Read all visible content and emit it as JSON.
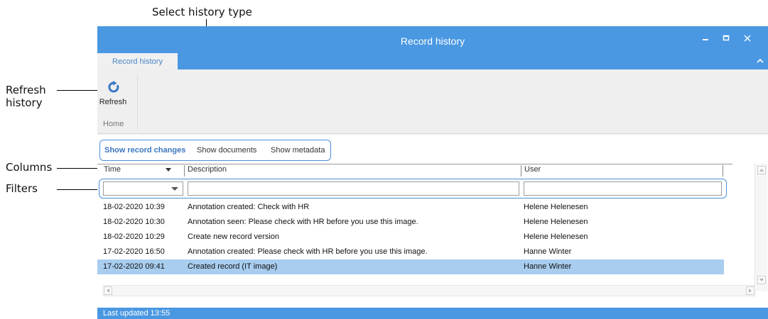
{
  "annotations": {
    "select_history_type": "Select history type",
    "refresh_history_line1": "Refresh",
    "refresh_history_line2": "history",
    "columns": "Columns",
    "filters": "Filters"
  },
  "window": {
    "title": "Record history",
    "minimize_icon": "minimize-icon",
    "maximize_icon": "maximize-icon",
    "close_icon": "close-icon",
    "accent_color": "#4a98e2"
  },
  "ribbon": {
    "tab_label": "Record history",
    "collapse_icon": "chevron-up-icon",
    "refresh_label": "Refresh",
    "refresh_icon": "refresh-icon",
    "group_label": "Home"
  },
  "history_types": [
    {
      "label": "Show record changes",
      "active": true
    },
    {
      "label": "Show documents",
      "active": false
    },
    {
      "label": "Show metadata",
      "active": false
    }
  ],
  "table": {
    "columns": [
      "Time",
      "Description",
      "User"
    ],
    "rows": [
      {
        "time": "18-02-2020 10:39",
        "description": "Annotation created: Check with HR",
        "user": "Helene Helenesen"
      },
      {
        "time": "18-02-2020 10:30",
        "description": "Annotation seen: Please check with HR before you use this image.",
        "user": "Helene Helenesen"
      },
      {
        "time": "18-02-2020 10:29",
        "description": "Create new record version",
        "user": "Helene Helenesen"
      },
      {
        "time": "17-02-2020 16:50",
        "description": "Annotation created: Please check with HR before you use this image.",
        "user": "Hanne Winter"
      },
      {
        "time": "17-02-2020 09:41",
        "description": "Created record (IT image)",
        "user": "Hanne Winter",
        "selected": true
      }
    ],
    "selected_row_color": "#a8cdef"
  },
  "filters": {
    "time_value": "",
    "description_value": "",
    "user_value": ""
  },
  "status": {
    "text": "Last updated 13:55"
  }
}
